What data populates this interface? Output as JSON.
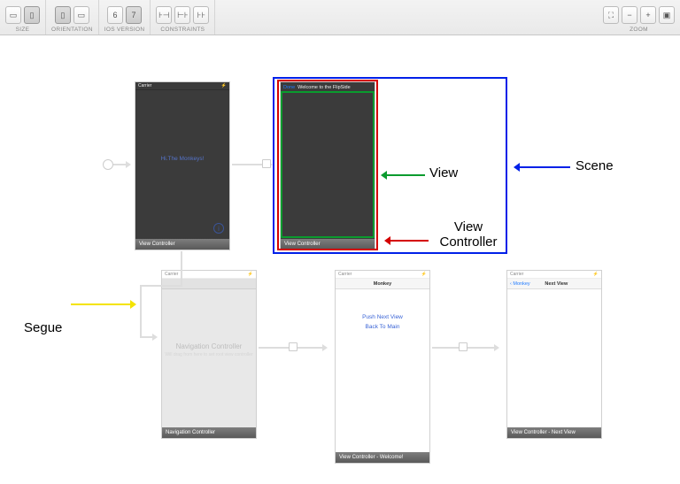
{
  "toolbar": {
    "size_label": "SIZE",
    "orientation_label": "ORIENTATION",
    "ios_label": "IOS VERSION",
    "ios_opts": [
      "6",
      "7"
    ],
    "constraints_label": "CONSTRAINTS",
    "zoom_label": "ZOOM"
  },
  "scenes": {
    "vc1": {
      "carrier": "Carrier",
      "center_text": "Hi.The Monkeys!",
      "footer": "View Controller"
    },
    "flipside": {
      "done": "Done",
      "title": "Welcome to the FlipSide",
      "footer": "View Controller"
    },
    "nav": {
      "carrier": "Carrier",
      "title": "Navigation Controller",
      "subtitle": "Will drag from here to set root view controller",
      "footer": "Navigation Controller"
    },
    "welcome": {
      "carrier": "Carrier",
      "title": "Monkey",
      "btn1": "Push Next View",
      "btn2": "Back To Main",
      "footer": "View Controller - Welcome!"
    },
    "next": {
      "carrier": "Carrier",
      "back": "Monkey",
      "title": "Next View",
      "footer": "View Controller - Next View"
    }
  },
  "annotations": {
    "view": "View",
    "view_controller": "View Controller",
    "scene": "Scene",
    "segue": "Segue"
  }
}
